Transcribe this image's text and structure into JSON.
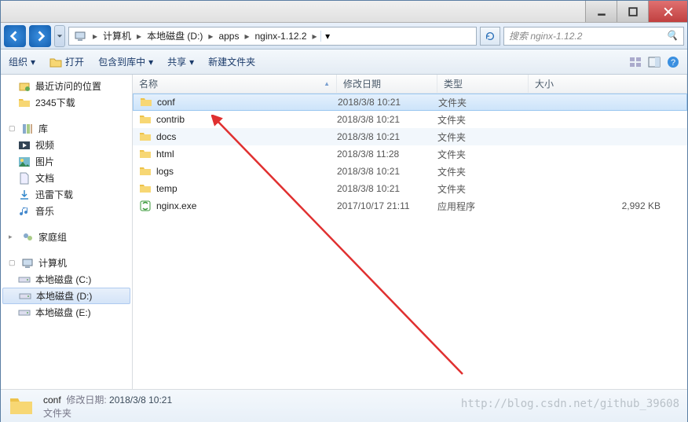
{
  "breadcrumb": [
    "计算机",
    "本地磁盘 (D:)",
    "apps",
    "nginx-1.12.2"
  ],
  "search_placeholder": "搜索 nginx-1.12.2",
  "toolbar": {
    "organize": "组织",
    "open": "打开",
    "include": "包含到库中",
    "share": "共享",
    "newfolder": "新建文件夹"
  },
  "columns": {
    "name": "名称",
    "date": "修改日期",
    "type": "类型",
    "size": "大小"
  },
  "sidebar": {
    "recent": "最近访问的位置",
    "dl2345": "2345下载",
    "libs": "库",
    "video": "视频",
    "pics": "图片",
    "docs": "文档",
    "xunlei": "迅雷下载",
    "music": "音乐",
    "homegroup": "家庭组",
    "computer": "计算机",
    "drive_c": "本地磁盘 (C:)",
    "drive_d": "本地磁盘 (D:)",
    "drive_e": "本地磁盘 (E:)"
  },
  "files": [
    {
      "name": "conf",
      "date": "2018/3/8 10:21",
      "type": "文件夹",
      "size": "",
      "icon": "folder",
      "selected": true
    },
    {
      "name": "contrib",
      "date": "2018/3/8 10:21",
      "type": "文件夹",
      "size": "",
      "icon": "folder"
    },
    {
      "name": "docs",
      "date": "2018/3/8 10:21",
      "type": "文件夹",
      "size": "",
      "icon": "folder"
    },
    {
      "name": "html",
      "date": "2018/3/8 11:28",
      "type": "文件夹",
      "size": "",
      "icon": "folder"
    },
    {
      "name": "logs",
      "date": "2018/3/8 10:21",
      "type": "文件夹",
      "size": "",
      "icon": "folder"
    },
    {
      "name": "temp",
      "date": "2018/3/8 10:21",
      "type": "文件夹",
      "size": "",
      "icon": "folder"
    },
    {
      "name": "nginx.exe",
      "date": "2017/10/17 21:11",
      "type": "应用程序",
      "size": "2,992 KB",
      "icon": "exe"
    }
  ],
  "details": {
    "name": "conf",
    "meta_label": "修改日期:",
    "meta_value": "2018/3/8 10:21",
    "type": "文件夹"
  },
  "watermark": "http://blog.csdn.net/github_39608"
}
